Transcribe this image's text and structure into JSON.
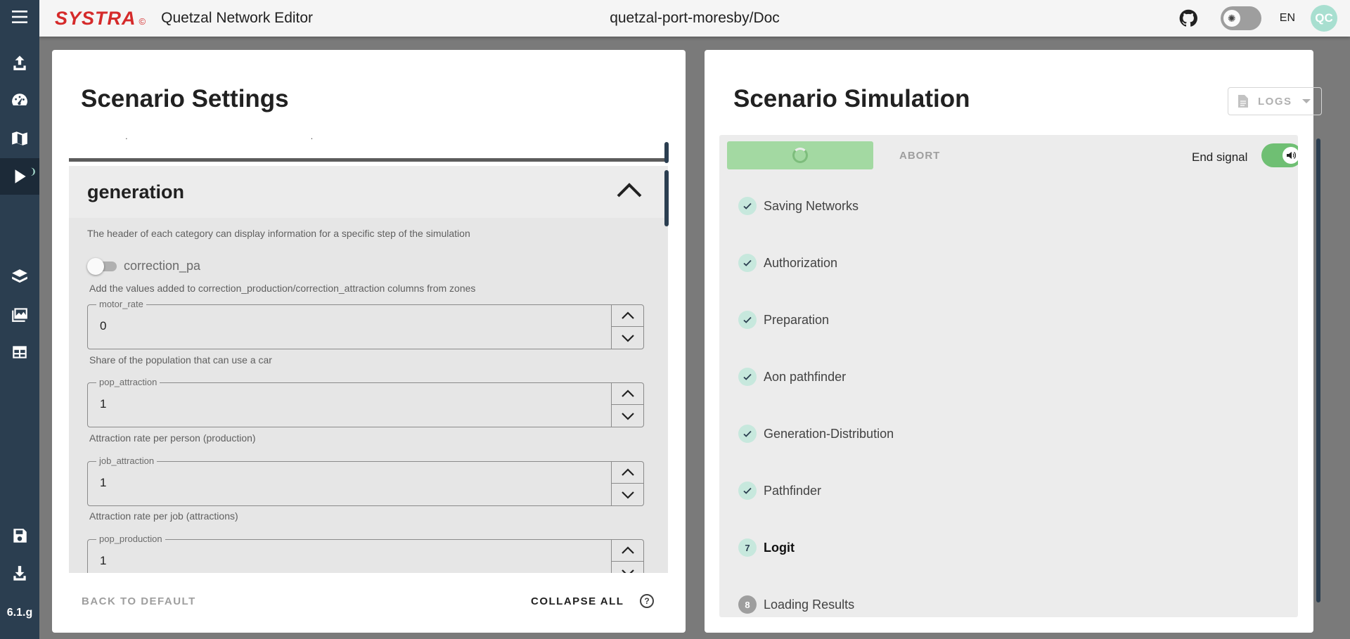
{
  "header": {
    "logo_text": "SYSTRA",
    "logo_copyright": "©",
    "app_title": "Quetzal Network Editor",
    "doc_title": "quetzal-port-moresby/Doc",
    "lang": "EN",
    "avatar_initials": "QC"
  },
  "sidebar": {
    "items": [
      {
        "name": "upload"
      },
      {
        "name": "dashboard"
      },
      {
        "name": "map"
      },
      {
        "name": "run",
        "active": true
      },
      {
        "name": "layers"
      },
      {
        "name": "gallery"
      },
      {
        "name": "tables"
      },
      {
        "name": "save"
      },
      {
        "name": "download"
      }
    ],
    "version": "6.1.g"
  },
  "left_panel": {
    "title": "Scenario Settings",
    "section": {
      "title": "generation",
      "description": "The header of each category can display information for a specific step of the simulation",
      "switch_label": "correction_pa",
      "switch_hint": "Add the values added to correction_production/correction_attraction columns from zones",
      "fields": [
        {
          "label": "motor_rate",
          "value": "0",
          "hint": "Share of the population that can use a car"
        },
        {
          "label": "pop_attraction",
          "value": "1",
          "hint": "Attraction rate per person (production)"
        },
        {
          "label": "job_attraction",
          "value": "1",
          "hint": "Attraction rate per job (attractions)"
        },
        {
          "label": "pop_production",
          "value": "1",
          "hint": ""
        }
      ]
    },
    "footer": {
      "back_default": "BACK TO DEFAULT",
      "collapse_all": "COLLAPSE ALL",
      "help": "?"
    }
  },
  "right_panel": {
    "title": "Scenario Simulation",
    "logs_label": "LOGS",
    "abort_label": "ABORT",
    "end_signal_label": "End signal",
    "steps": [
      {
        "label": "Saving Networks",
        "status": "done"
      },
      {
        "label": "Authorization",
        "status": "done"
      },
      {
        "label": "Preparation",
        "status": "done"
      },
      {
        "label": "Aon pathfinder",
        "status": "done"
      },
      {
        "label": "Generation-Distribution",
        "status": "done"
      },
      {
        "label": "Pathfinder",
        "status": "done"
      },
      {
        "label": "Logit",
        "status": "active",
        "number": "7"
      },
      {
        "label": "Loading Results",
        "status": "pending",
        "number": "8"
      }
    ]
  },
  "colors": {
    "sidebar": "#2b3e50",
    "brand_red": "#d52a2a",
    "accent_green": "#6fbf73",
    "step_done": "#c7e8dd"
  }
}
